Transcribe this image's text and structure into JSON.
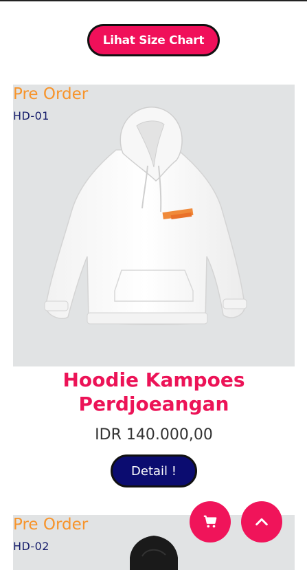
{
  "header": {
    "size_chart_label": "Lihat Size Chart"
  },
  "products": [
    {
      "badge": "Pre Order",
      "code": "HD-01",
      "name": "Hoodie Kampoes Perdjoeangan",
      "price": "IDR 140.000,00",
      "detail_label": "Detail !"
    },
    {
      "badge": "Pre Order",
      "code": "HD-02"
    }
  ],
  "floating": {
    "cart_icon": "cart-icon",
    "scroll_top_icon": "chevron-up-icon"
  },
  "colors": {
    "accent": "#f0105a",
    "badge": "#f7942b",
    "navy": "#0b0c70"
  }
}
